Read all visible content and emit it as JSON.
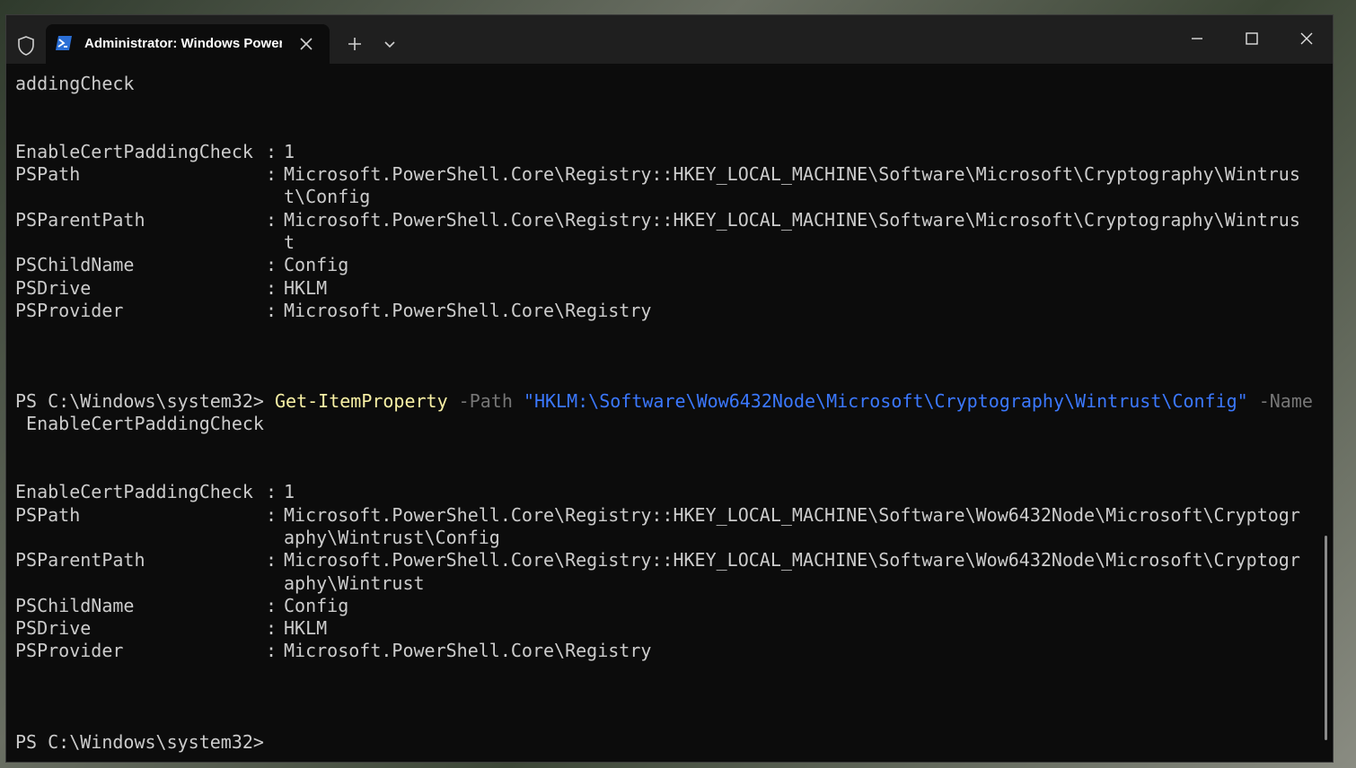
{
  "titlebar": {
    "tab_title": "Administrator: Windows PowerShell"
  },
  "colors": {
    "background": "#0c0c0c",
    "text": "#cccccc",
    "command": "#f9f1a5",
    "parameter": "#767676",
    "string": "#3b78ff"
  },
  "icons": {
    "shield": "shield-icon",
    "powershell": "powershell-icon",
    "close": "close-icon",
    "plus": "plus-icon",
    "dropdown": "chevron-down-icon",
    "minimize": "minimize-icon",
    "maximize": "maximize-icon",
    "window_close": "window-close-icon"
  },
  "terminal": {
    "top_fragment": "addingCheck",
    "block1": {
      "rows": [
        {
          "label": "EnableCertPaddingCheck",
          "value": "1"
        },
        {
          "label": "PSPath",
          "value": "Microsoft.PowerShell.Core\\Registry::HKEY_LOCAL_MACHINE\\Software\\Microsoft\\Cryptography\\Wintrus",
          "cont": "t\\Config"
        },
        {
          "label": "PSParentPath",
          "value": "Microsoft.PowerShell.Core\\Registry::HKEY_LOCAL_MACHINE\\Software\\Microsoft\\Cryptography\\Wintrus",
          "cont": "t"
        },
        {
          "label": "PSChildName",
          "value": "Config"
        },
        {
          "label": "PSDrive",
          "value": "HKLM"
        },
        {
          "label": "PSProvider",
          "value": "Microsoft.PowerShell.Core\\Registry"
        }
      ]
    },
    "command_line": {
      "prompt": "PS C:\\Windows\\system32> ",
      "cmdlet": "Get-ItemProperty",
      "path_param": " -Path ",
      "path_value": "\"HKLM:\\Software\\Wow6432Node\\Microsoft\\Cryptography\\Wintrust\\Config\"",
      "name_param": " -Name",
      "name_value": " EnableCertPaddingCheck"
    },
    "block2": {
      "rows": [
        {
          "label": "EnableCertPaddingCheck",
          "value": "1"
        },
        {
          "label": "PSPath",
          "value": "Microsoft.PowerShell.Core\\Registry::HKEY_LOCAL_MACHINE\\Software\\Wow6432Node\\Microsoft\\Cryptogr",
          "cont": "aphy\\Wintrust\\Config"
        },
        {
          "label": "PSParentPath",
          "value": "Microsoft.PowerShell.Core\\Registry::HKEY_LOCAL_MACHINE\\Software\\Wow6432Node\\Microsoft\\Cryptogr",
          "cont": "aphy\\Wintrust"
        },
        {
          "label": "PSChildName",
          "value": "Config"
        },
        {
          "label": "PSDrive",
          "value": "HKLM"
        },
        {
          "label": "PSProvider",
          "value": "Microsoft.PowerShell.Core\\Registry"
        }
      ]
    },
    "final_prompt": "PS C:\\Windows\\system32>",
    "colon": ":"
  }
}
